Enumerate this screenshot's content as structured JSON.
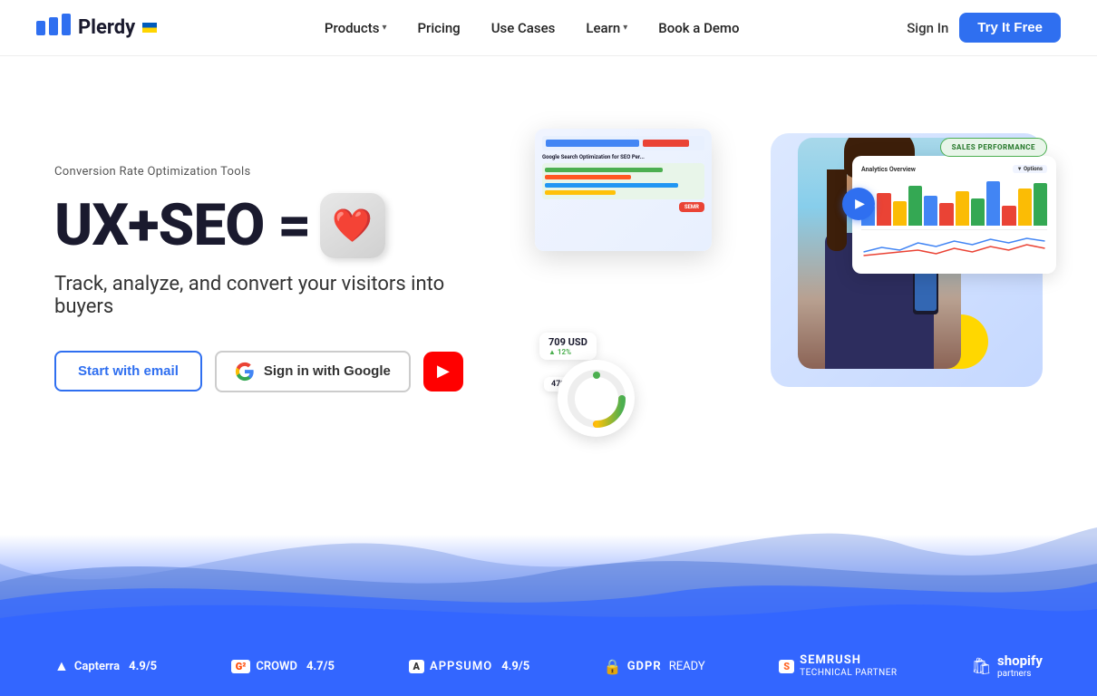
{
  "navbar": {
    "logo_text": "Plerdy",
    "nav_items": [
      {
        "label": "Products",
        "has_chevron": true
      },
      {
        "label": "Pricing",
        "has_chevron": false
      },
      {
        "label": "Use Cases",
        "has_chevron": false
      },
      {
        "label": "Learn",
        "has_chevron": true
      },
      {
        "label": "Book a Demo",
        "has_chevron": false
      }
    ],
    "sign_in": "Sign In",
    "try_free": "Try It Free"
  },
  "hero": {
    "subtitle": "Conversion Rate Optimization Tools",
    "headline": "UX+SEO =",
    "tagline": "Track, analyze, and convert your visitors into buyers",
    "cta_email": "Start with email",
    "cta_google": "Sign in with Google",
    "analytics_badge": "SALES PERFORMANCE",
    "price_tag": "709 USD",
    "price_tag2": "479 (56%)"
  },
  "bottom_bar": {
    "partners": [
      {
        "icon": "▲",
        "name": "Capterra",
        "rating": "4.9/5"
      },
      {
        "icon": "G²",
        "name": "CROWD",
        "rating": "4.7/5"
      },
      {
        "icon": "A",
        "name": "APPSUMO",
        "rating": "4.9/5"
      },
      {
        "icon": "🔒",
        "name": "GDPR",
        "suffix": "READY"
      },
      {
        "icon": "S",
        "name": "SEMRUSH",
        "suffix": "TECHNICAL PARTNER"
      },
      {
        "icon": "🛍",
        "name": "shopify",
        "suffix": "partners"
      }
    ]
  },
  "colors": {
    "primary": "#2f6ff0",
    "dark": "#1a1a2e",
    "green": "#4CAF50",
    "red": "#FF0000"
  }
}
